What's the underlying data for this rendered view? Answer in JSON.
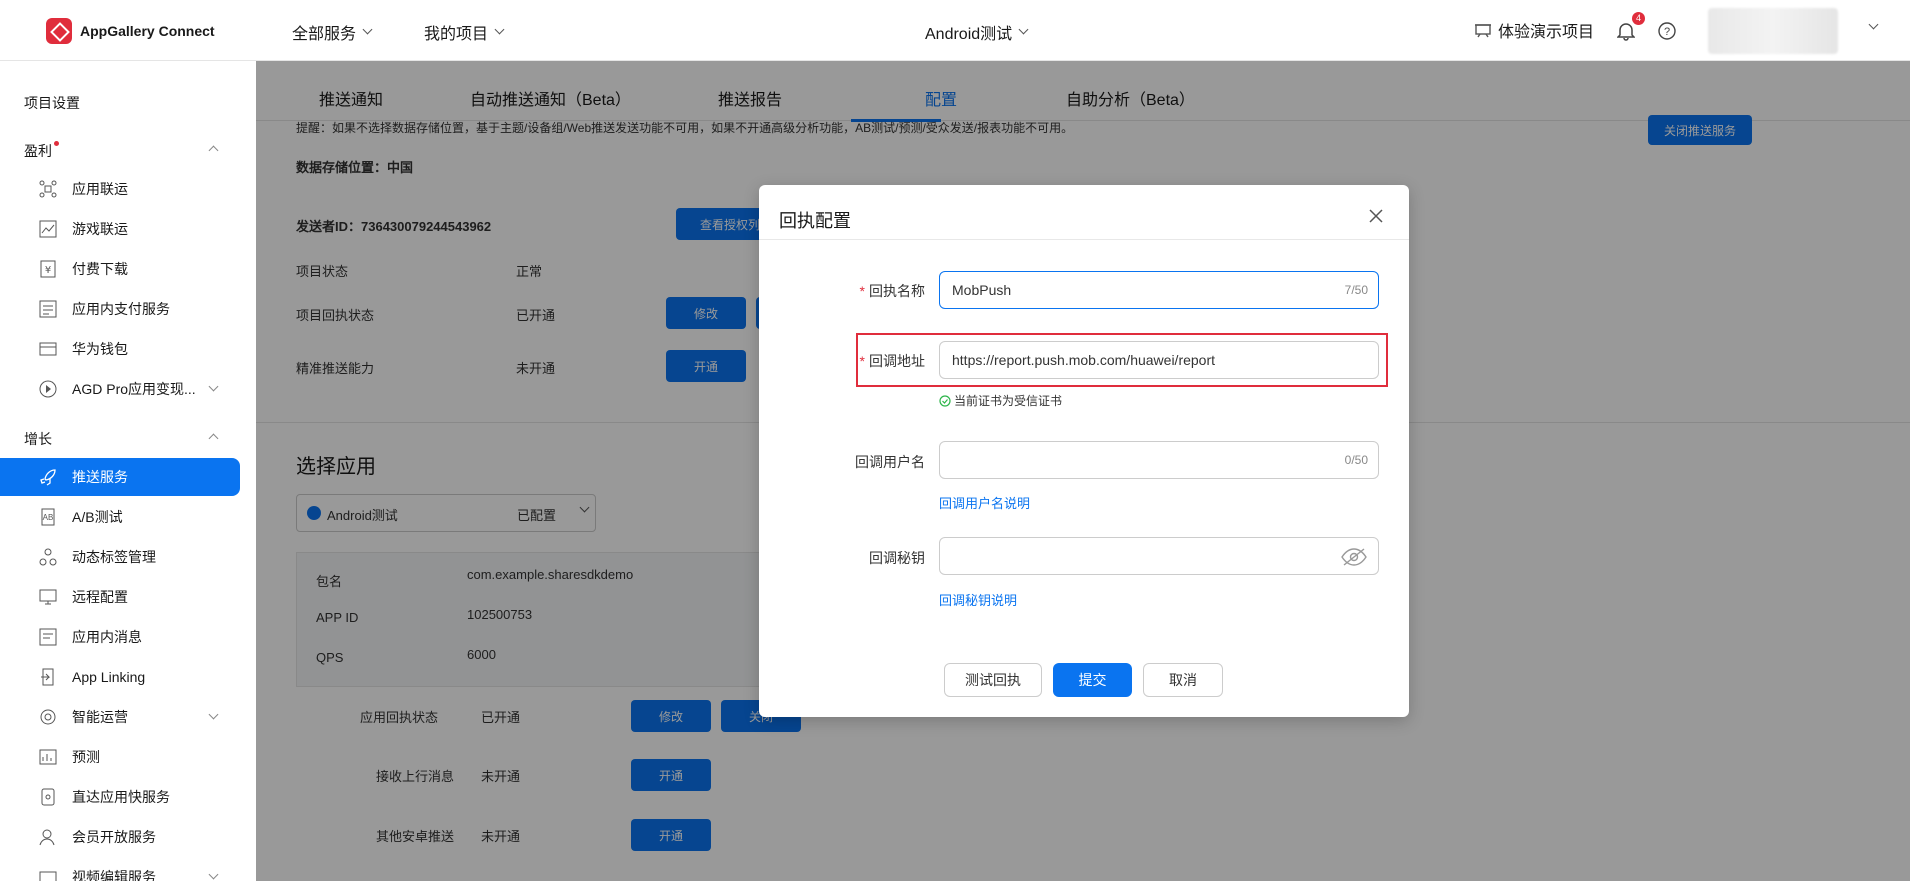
{
  "app": {
    "logo_text": "AppGallery Connect"
  },
  "topnav": {
    "all_services": "全部服务",
    "my_projects": "我的项目",
    "project": "Android测试",
    "demo": "体验演示项目",
    "notification_count": "4"
  },
  "sidebar": {
    "project_settings": "项目设置",
    "monetize": "盈利",
    "monetize_items": [
      "应用联运",
      "游戏联运",
      "付费下载",
      "应用内支付服务",
      "华为钱包",
      "AGD Pro应用变现..."
    ],
    "grow": "增长",
    "grow_items": [
      "推送服务",
      "A/B测试",
      "动态标签管理",
      "远程配置",
      "应用内消息",
      "App Linking",
      "智能运营",
      "预测",
      "直达应用快服务",
      "会员开放服务",
      "视频编辑服务"
    ]
  },
  "tabs": [
    "推送通知",
    "自动推送通知（Beta）",
    "推送报告",
    "配置",
    "自助分析（Beta）"
  ],
  "content": {
    "notice": "提醒：如果不选择数据存储位置，基于主题/设备组/Web推送发送功能不可用，如果不开通高级分析功能，AB测试/预测/受众发送/报表功能不可用。",
    "close_push": "关闭推送服务",
    "storage": "数据存储位置：中国",
    "sender_id": "发送者ID：736430079244543962",
    "view_auth": "查看授权列表",
    "project_status_label": "项目状态",
    "project_status_value": "正常",
    "receipt_status_label": "项目回执状态",
    "receipt_status_value": "已开通",
    "precise_label": "精准推送能力",
    "precise_value": "未开通",
    "modify": "修改",
    "enable": "开通",
    "close": "关闭",
    "select_app": "选择应用",
    "app_name": "Android测试",
    "app_configured": "已配置",
    "pkg_label": "包名",
    "pkg_value": "com.example.sharesdkdemo",
    "appid_label": "APP ID",
    "appid_value": "102500753",
    "qps_label": "QPS",
    "qps_value": "6000",
    "app_receipt_label": "应用回执状态",
    "app_receipt_value": "已开通",
    "upstream_label": "接收上行消息",
    "upstream_value": "未开通",
    "android_label": "其他安卓推送",
    "android_value": "未开通"
  },
  "modal": {
    "title": "回执配置",
    "name_label": "回执名称",
    "name_value": "MobPush",
    "name_count": "7/50",
    "url_label": "回调地址",
    "url_value": "https://report.push.mob.com/huawei/report",
    "cert_note": "当前证书为受信证书",
    "user_label": "回调用户名",
    "user_count": "0/50",
    "user_help": "回调用户名说明",
    "secret_label": "回调秘钥",
    "secret_help": "回调秘钥说明",
    "btn_test": "测试回执",
    "btn_submit": "提交",
    "btn_cancel": "取消"
  },
  "colors": {
    "accent": "#0a74f0",
    "danger": "#e02d3c"
  }
}
